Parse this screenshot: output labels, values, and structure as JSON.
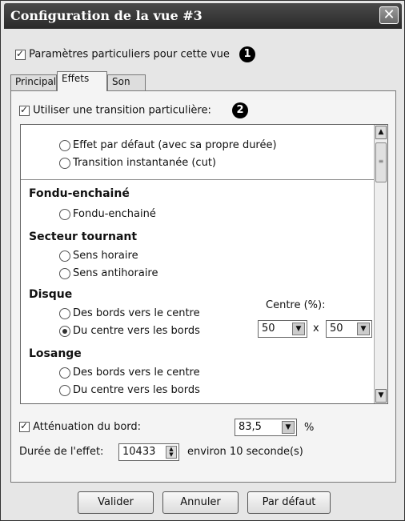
{
  "window": {
    "title": "Configuration de la vue #3",
    "close_glyph": "✕"
  },
  "particular": {
    "label": "Paramètres particuliers pour cette vue",
    "checked": true,
    "badge": "1"
  },
  "tabs": [
    {
      "label": "Principal",
      "active": false
    },
    {
      "label": "Effets",
      "active": true
    },
    {
      "label": "Son",
      "active": false
    }
  ],
  "transition": {
    "label": "Utiliser une transition particulière:",
    "checked": true,
    "badge": "2"
  },
  "list": {
    "default_options": [
      {
        "label": "Effet par défaut (avec sa propre durée)",
        "selected": false
      },
      {
        "label": "Transition instantanée (cut)",
        "selected": false
      }
    ],
    "groups": [
      {
        "title": "Fondu-enchainé",
        "options": [
          {
            "label": "Fondu-enchainé",
            "selected": false
          }
        ]
      },
      {
        "title": "Secteur tournant",
        "options": [
          {
            "label": "Sens horaire",
            "selected": false
          },
          {
            "label": "Sens antihoraire",
            "selected": false
          }
        ]
      },
      {
        "title": "Disque",
        "options": [
          {
            "label": "Des bords vers le centre",
            "selected": false
          },
          {
            "label": "Du centre vers les bords",
            "selected": true
          }
        ]
      },
      {
        "title": "Losange",
        "options": [
          {
            "label": "Des bords vers le centre",
            "selected": false
          },
          {
            "label": "Du centre vers les bords",
            "selected": false
          }
        ]
      }
    ],
    "centre": {
      "label": "Centre (%):",
      "x_value": "50",
      "y_value": "50",
      "separator": "x"
    }
  },
  "attenuation": {
    "label": "Atténuation du bord:",
    "checked": true,
    "value": "83,5",
    "unit": "%"
  },
  "duration": {
    "label": "Durée de l'effet:",
    "value": "10433",
    "note": "environ 10 seconde(s)"
  },
  "buttons": {
    "ok": "Valider",
    "cancel": "Annuler",
    "default": "Par défaut"
  }
}
